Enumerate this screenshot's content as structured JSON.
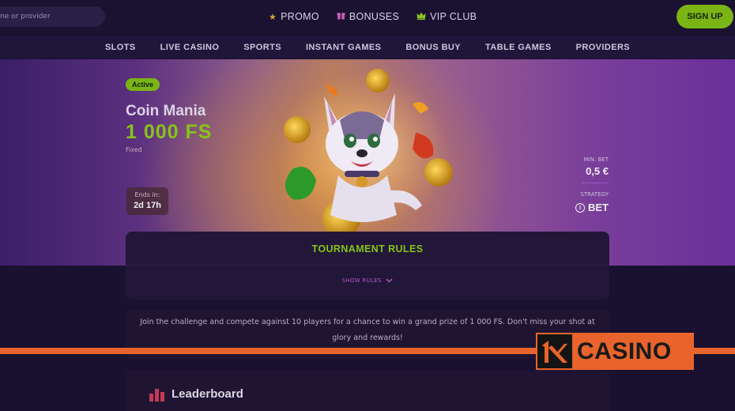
{
  "search": {
    "placeholder": "ne or provider"
  },
  "topnav": {
    "promo": "PROMO",
    "bonuses": "BONUSES",
    "vip": "VIP CLUB",
    "signup": "SIGN UP"
  },
  "categories": [
    "SLOTS",
    "LIVE CASINO",
    "SPORTS",
    "INSTANT GAMES",
    "BONUS BUY",
    "TABLE GAMES",
    "PROVIDERS"
  ],
  "tournament": {
    "status": "Active",
    "title": "Coin Mania",
    "prize": "1 000 FS",
    "prize_type": "Fixed",
    "ends_label": "Ends in:",
    "ends_value": "2d  17h",
    "min_bet_label": "MIN. BET",
    "min_bet_value": "0,5 €",
    "strategy_label": "STRATEGY",
    "strategy_value": "BET"
  },
  "rules": {
    "title": "TOURNAMENT RULES",
    "show": "SHOW RULES"
  },
  "description": "Join the challenge and compete against 10 players for a chance to win a grand prize of 1 000 FS. Don't miss your shot at glory and rewards!",
  "leaderboard": {
    "title": "Leaderboard"
  },
  "watermark": {
    "text": "CASINO",
    "logo_mark": "1X"
  },
  "colors": {
    "accent_green": "#7ab515",
    "accent_purple": "#b05cc8",
    "watermark_orange": "#e8642c"
  },
  "icons": {
    "promo": "star-icon",
    "bonuses": "gift-icon",
    "vip": "crown-icon",
    "leaderboard": "bar-chart-icon",
    "strategy": "info-icon",
    "show_rules": "chevron-down-icon"
  }
}
